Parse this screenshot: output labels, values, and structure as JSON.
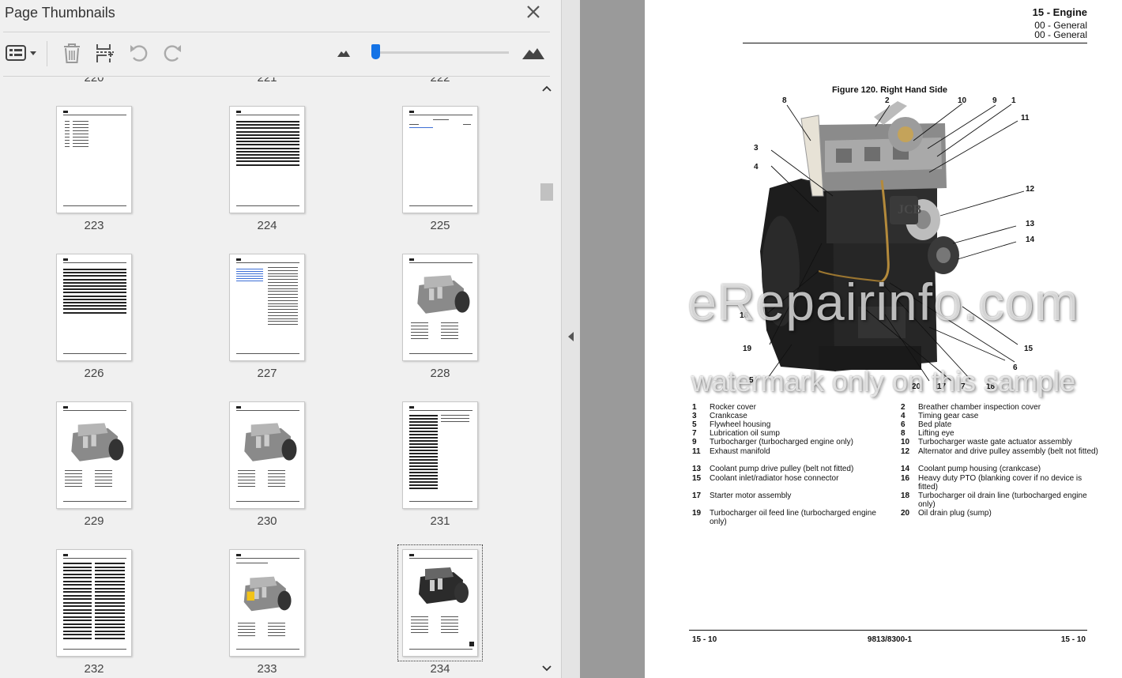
{
  "panel": {
    "title": "Page Thumbnails",
    "tools": [
      "options-menu",
      "delete-pages",
      "insert-pages",
      "rotate-counterclockwise",
      "rotate-clockwise"
    ],
    "thumbnail_zoom_percent": 3,
    "cut_off_labels": [
      "220",
      "221",
      "222"
    ],
    "thumbnails": [
      {
        "page": "223",
        "kind": "index"
      },
      {
        "page": "224",
        "kind": "lines"
      },
      {
        "page": "225",
        "kind": "toc"
      },
      {
        "page": "226",
        "kind": "lines"
      },
      {
        "page": "227",
        "kind": "twocol"
      },
      {
        "page": "228",
        "kind": "engine"
      },
      {
        "page": "229",
        "kind": "engine"
      },
      {
        "page": "230",
        "kind": "engine"
      },
      {
        "page": "231",
        "kind": "text"
      },
      {
        "page": "232",
        "kind": "table"
      },
      {
        "page": "233",
        "kind": "engine-yellow"
      },
      {
        "page": "234",
        "kind": "engine-dark",
        "selected": true
      }
    ]
  },
  "document": {
    "header": {
      "section": "15 - Engine",
      "sub1": "00 - General",
      "sub2": "00 - General"
    },
    "figure_caption": "Figure 120. Right Hand Side",
    "callouts": [
      "1",
      "2",
      "3",
      "4",
      "5",
      "6",
      "7",
      "8",
      "9",
      "10",
      "11",
      "12",
      "13",
      "14",
      "15",
      "16",
      "17",
      "18",
      "19",
      "20"
    ],
    "watermark_main": "eRepairinfo.com",
    "watermark_sub": "watermark only on this sample",
    "legend": [
      {
        "n": "1",
        "t": "Rocker cover"
      },
      {
        "n": "2",
        "t": "Breather chamber inspection cover"
      },
      {
        "n": "3",
        "t": "Crankcase"
      },
      {
        "n": "4",
        "t": "Timing gear case"
      },
      {
        "n": "5",
        "t": "Flywheel housing"
      },
      {
        "n": "6",
        "t": "Bed plate"
      },
      {
        "n": "7",
        "t": "Lubrication oil sump"
      },
      {
        "n": "8",
        "t": "Lifting eye"
      },
      {
        "n": "9",
        "t": "Turbocharger (turbocharged engine only)"
      },
      {
        "n": "10",
        "t": "Turbocharger waste gate actuator assembly"
      },
      {
        "n": "11",
        "t": "Exhaust manifold"
      },
      {
        "n": "12",
        "t": "Alternator and drive pulley assembly (belt not fitted)"
      },
      {
        "n": "13",
        "t": "Coolant pump drive pulley (belt not fitted)"
      },
      {
        "n": "14",
        "t": "Coolant pump housing (crankcase)"
      },
      {
        "n": "15",
        "t": "Coolant inlet/radiator hose connector"
      },
      {
        "n": "16",
        "t": "Heavy duty PTO (blanking cover if no device is fitted)"
      },
      {
        "n": "17",
        "t": "Starter motor assembly"
      },
      {
        "n": "18",
        "t": "Turbocharger oil drain line (turbocharged engine only)"
      },
      {
        "n": "19",
        "t": "Turbocharger oil feed line (turbocharged engine only)"
      },
      {
        "n": "20",
        "t": "Oil drain plug (sump)"
      }
    ],
    "footer": {
      "left": "15 - 10",
      "center": "9813/8300-1",
      "right": "15 - 10"
    }
  }
}
